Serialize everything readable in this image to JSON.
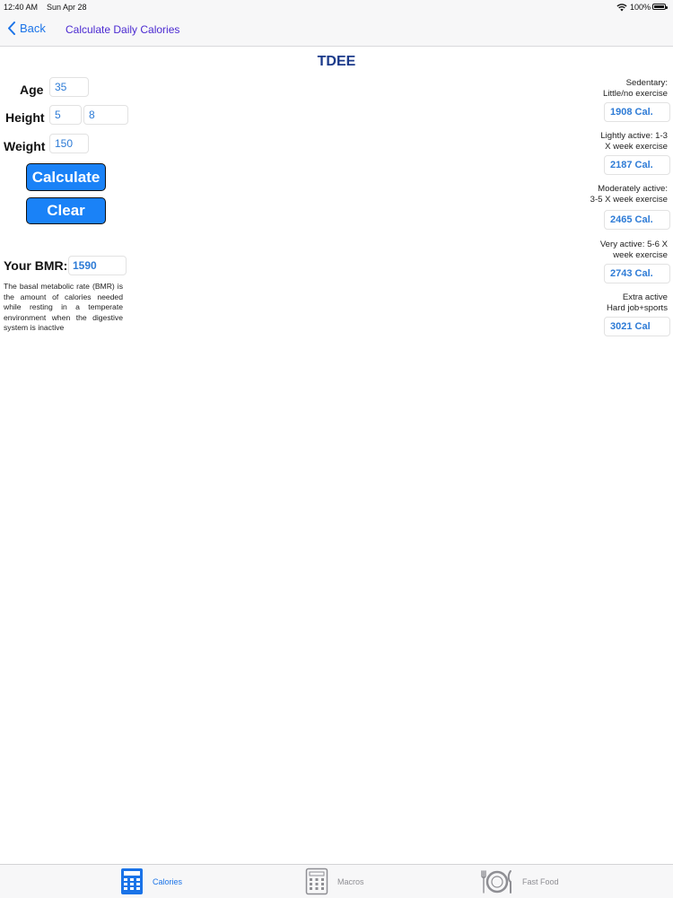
{
  "status_bar": {
    "time": "12:40 AM",
    "date": "Sun Apr 28",
    "battery": "100%"
  },
  "nav": {
    "back_label": "Back",
    "title": "Calculate Daily Calories"
  },
  "tdee_title": "TDEE",
  "form": {
    "age_label": "Age",
    "age_value": "35",
    "height_label": "Height",
    "height_feet": "5",
    "height_inches": "8",
    "weight_label": "Weight",
    "weight_value": "150",
    "calculate_label": "Calculate",
    "clear_label": "Clear"
  },
  "bmr": {
    "label": "Your BMR:",
    "value": "1590",
    "description": "The basal metabolic rate (BMR) is the amount of calories needed while resting in a temperate environment when the digestive system is inactive"
  },
  "activity_levels": [
    {
      "line1": "Sedentary:",
      "line2": "Little/no exercise",
      "value": "1908 Cal."
    },
    {
      "line1": "Lightly active: 1-3",
      "line2": "X week exercise",
      "value": "2187 Cal."
    },
    {
      "line1": "Moderately active:",
      "line2": "3-5 X week exercise",
      "value": "2465 Cal."
    },
    {
      "line1": "Very active: 5-6 X",
      "line2": "week exercise",
      "value": "2743 Cal."
    },
    {
      "line1": "Extra active",
      "line2": "Hard job+sports",
      "value": "3021 Cal"
    }
  ],
  "tabs": [
    {
      "label": "Calories",
      "icon": "calculator-icon",
      "active": true
    },
    {
      "label": "Macros",
      "icon": "calculator-outline-icon",
      "active": false
    },
    {
      "label": "Fast Food",
      "icon": "plate-fork-knife-icon",
      "active": false
    }
  ],
  "colors": {
    "accent": "#1a73e8",
    "button": "#1a82f7",
    "title": "#1b3a8a",
    "nav_title": "#4b2ad1",
    "value_text": "#2d7bd6"
  }
}
